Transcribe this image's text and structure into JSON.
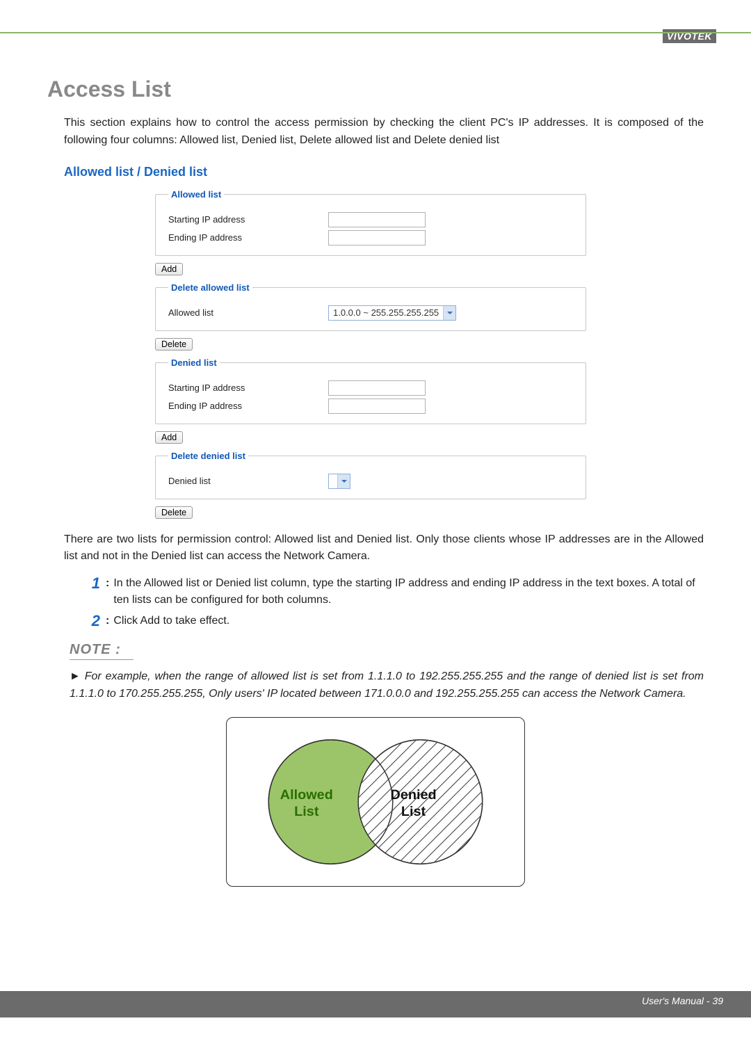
{
  "brand": "VIVOTEK",
  "title": "Access List",
  "intro": "This section explains how to control the access permission by checking the client PC's IP addresses. It is composed of the following four columns: Allowed list, Denied list, Delete allowed list and Delete denied list",
  "subtitle": "Allowed list / Denied list",
  "panel": {
    "allowed": {
      "legend": "Allowed list",
      "start_label": "Starting IP address",
      "end_label": "Ending IP address",
      "add_btn": "Add"
    },
    "delete_allowed": {
      "legend": "Delete allowed list",
      "label": "Allowed list",
      "selected": "1.0.0.0 ~ 255.255.255.255",
      "delete_btn": "Delete"
    },
    "denied": {
      "legend": "Denied list",
      "start_label": "Starting IP address",
      "end_label": "Ending IP address",
      "add_btn": "Add"
    },
    "delete_denied": {
      "legend": "Delete denied list",
      "label": "Denied list",
      "selected": "",
      "delete_btn": "Delete"
    }
  },
  "after_panel": "There are two lists for permission control: Allowed list and Denied list. Only those clients whose IP addresses are in the Allowed list and not in the Denied list can access the Network Camera.",
  "steps": [
    {
      "num": "1",
      "text": "In the Allowed list or Denied list column, type the starting IP address and ending IP address in the text boxes.  A total of ten lists can be configured for both columns."
    },
    {
      "num": "2",
      "text": "Click Add to take effect."
    }
  ],
  "note_label": "NOTE  :",
  "note_body": "► For example, when the range of allowed list is set from 1.1.1.0 to 192.255.255.255 and the range of denied list is set from 1.1.1.0 to 170.255.255.255, Only users' IP located between 171.0.0.0 and 192.255.255.255 can access the Network Camera.",
  "diagram": {
    "allowed_label": "Allowed List",
    "denied_label": "Denied List"
  },
  "footer": "User's Manual - 39"
}
